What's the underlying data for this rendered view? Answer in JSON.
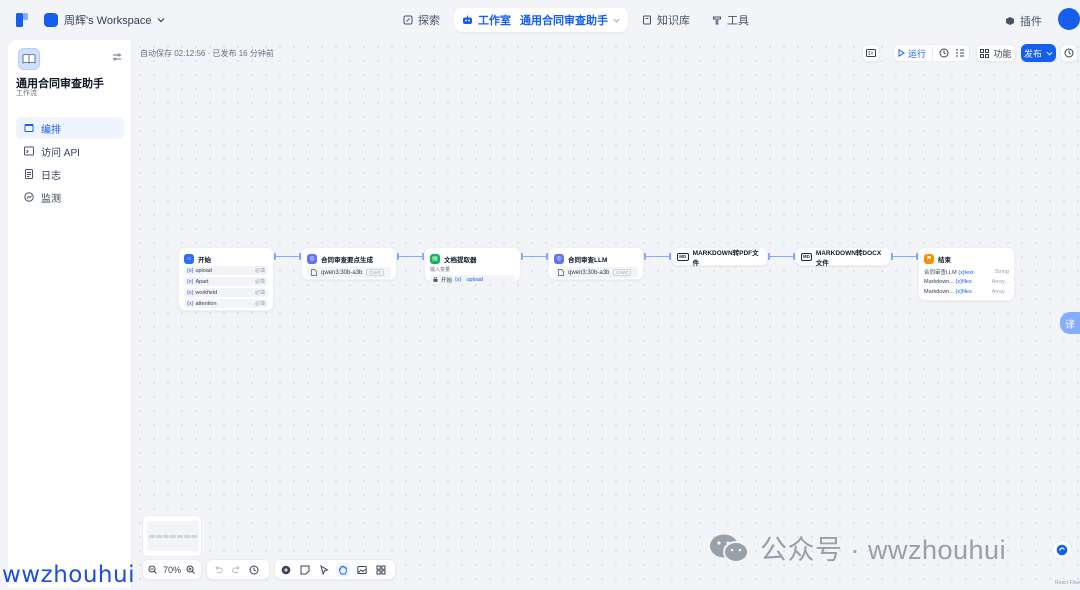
{
  "header": {
    "workspace": "周辉's Workspace",
    "nav": [
      {
        "label": "探索"
      },
      {
        "label": "工作室",
        "sub": "通用合同审查助手"
      },
      {
        "label": "知识库"
      },
      {
        "label": "工具"
      }
    ],
    "plugin_label": "插件"
  },
  "sidebar": {
    "app_name": "通用合同审查助手",
    "app_type": "工作流",
    "items": [
      {
        "label": "编排",
        "icon": "layout-icon",
        "active": true
      },
      {
        "label": "访问 API",
        "icon": "terminal-icon"
      },
      {
        "label": "日志",
        "icon": "file-text-icon"
      },
      {
        "label": "监测",
        "icon": "monitor-icon"
      }
    ]
  },
  "canvas": {
    "autosave": "自动保存 02:12:56 · 已发布 16 分钟前",
    "toolbar": {
      "run": "运行",
      "features": "功能",
      "publish": "发布"
    },
    "nodes": {
      "start": {
        "title": "开始",
        "vars": [
          {
            "name": "upload",
            "req": "必填"
          },
          {
            "name": "Apart",
            "req": "必填"
          },
          {
            "name": "workfield",
            "req": "必填"
          },
          {
            "name": "attention",
            "req": "必填"
          }
        ]
      },
      "llm1": {
        "title": "合同审查要点生成",
        "model": "qwen3:30b-a3b",
        "tag": "CHAT"
      },
      "extractor": {
        "title": "文档提取器",
        "sub": "输入变量",
        "src": "开始",
        "var": "upload"
      },
      "llm2": {
        "title": "合同审查LLM",
        "model": "qwen3:30b-a3b",
        "tag": "CHAT"
      },
      "md_pdf": {
        "title": "MARKDOWN转PDF文件",
        "badge": "MD"
      },
      "md_docx": {
        "title": "MARKDOWN转DOCX文件",
        "badge": "MD"
      },
      "end": {
        "title": "结束",
        "outputs": [
          {
            "src": "合同审查LLM",
            "name": "text",
            "type": "String"
          },
          {
            "src": "Markdown...",
            "name": "files",
            "type": "Array..."
          },
          {
            "src": "Markdown...",
            "name": "files",
            "type": "Array..."
          }
        ]
      }
    },
    "zoom": "70%",
    "translate_btn": "译",
    "react_flow": "React Flow"
  },
  "watermark": {
    "center": "公众号 · wwzhouhui",
    "left": "wwzhouhui"
  },
  "colors": {
    "accent": "#155eef",
    "edge": "#84adff",
    "start": "#296dff",
    "llm": "#6172f3",
    "extractor": "#16b364",
    "end": "#f79009"
  }
}
